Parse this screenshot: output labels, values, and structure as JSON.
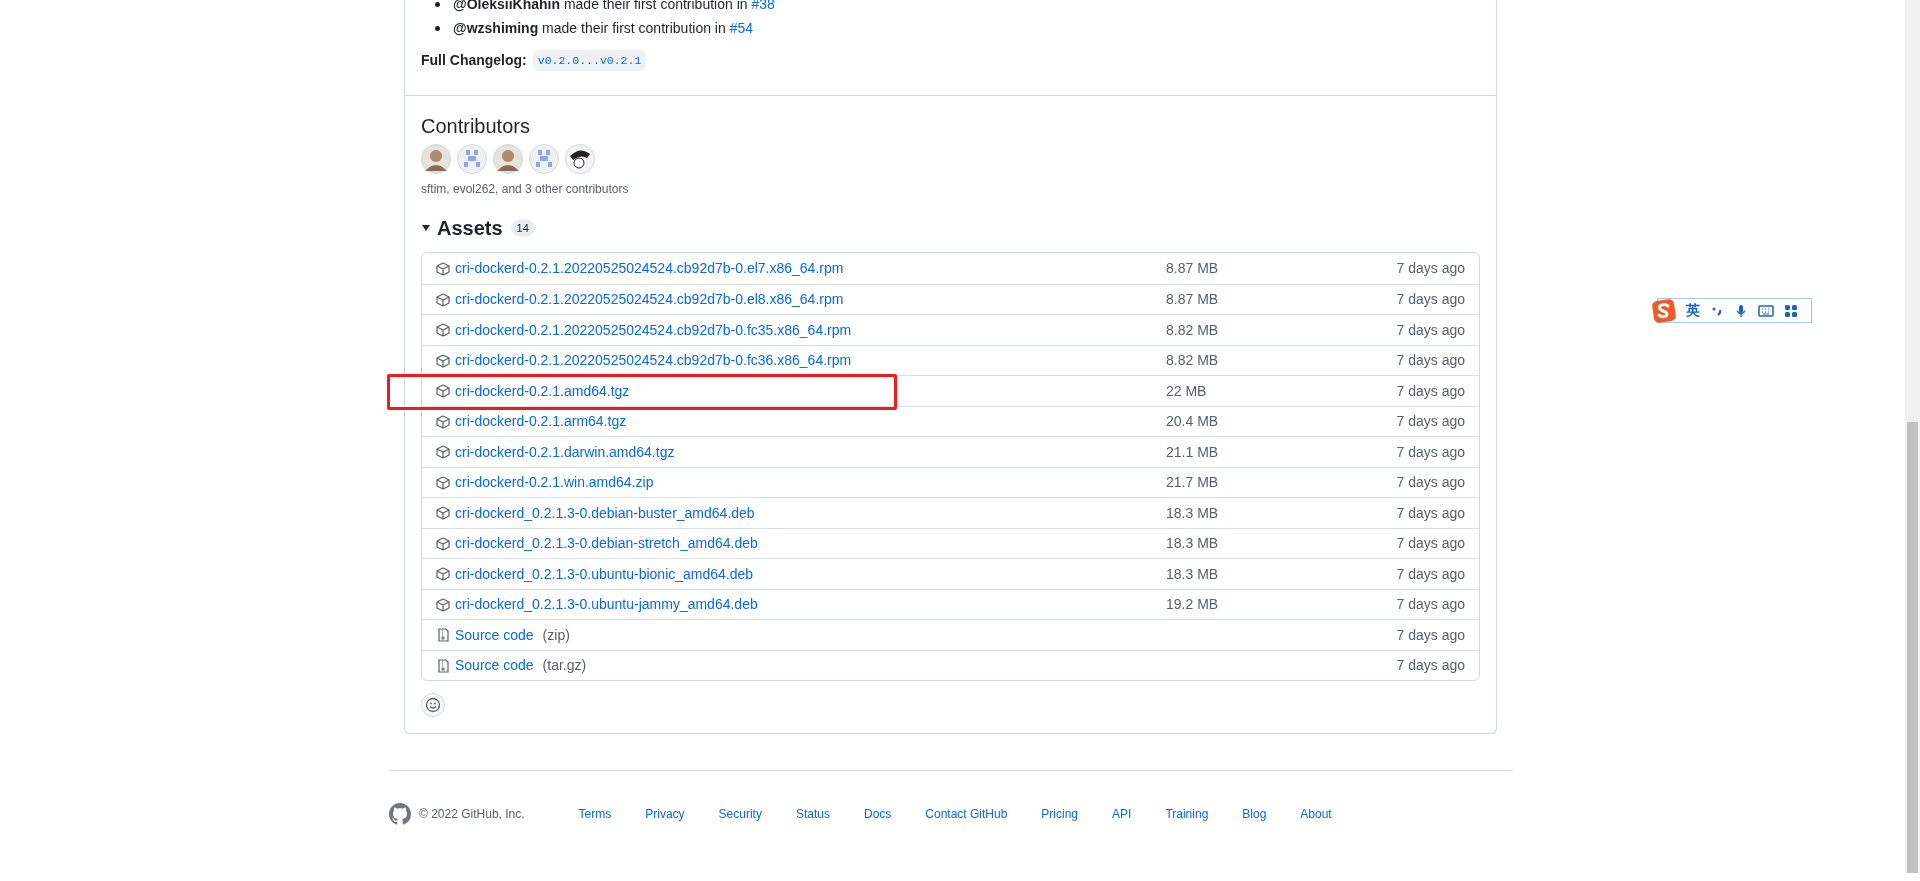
{
  "release_notes": {
    "new_contributors": [
      {
        "user": "@OleksiiKhahin",
        "text": "made their first contribution in",
        "link": "#38"
      },
      {
        "user": "@wzshiming",
        "text": "made their first contribution in",
        "link": "#54"
      }
    ],
    "changelog_label": "Full Changelog:",
    "changelog_link": "v0.2.0...v0.2.1"
  },
  "contributors": {
    "title": "Contributors",
    "avatars": [
      {
        "kind": "photo"
      },
      {
        "kind": "identicon"
      },
      {
        "kind": "photo"
      },
      {
        "kind": "identicon"
      },
      {
        "kind": "cartoon"
      }
    ],
    "summary": "sftim, evol262, and 3 other contributors"
  },
  "assets": {
    "title": "Assets",
    "count": "14",
    "expanded": true,
    "items": [
      {
        "kind": "package",
        "name": "cri-dockerd-0.2.1.20220525024524.cb92d7b-0.el7.x86_64.rpm",
        "size": "8.87 MB",
        "date": "7 days ago",
        "highlighted": false
      },
      {
        "kind": "package",
        "name": "cri-dockerd-0.2.1.20220525024524.cb92d7b-0.el8.x86_64.rpm",
        "size": "8.87 MB",
        "date": "7 days ago",
        "highlighted": false
      },
      {
        "kind": "package",
        "name": "cri-dockerd-0.2.1.20220525024524.cb92d7b-0.fc35.x86_64.rpm",
        "size": "8.82 MB",
        "date": "7 days ago",
        "highlighted": false
      },
      {
        "kind": "package",
        "name": "cri-dockerd-0.2.1.20220525024524.cb92d7b-0.fc36.x86_64.rpm",
        "size": "8.82 MB",
        "date": "7 days ago",
        "highlighted": false
      },
      {
        "kind": "package",
        "name": "cri-dockerd-0.2.1.amd64.tgz",
        "size": "22 MB",
        "date": "7 days ago",
        "highlighted": true
      },
      {
        "kind": "package",
        "name": "cri-dockerd-0.2.1.arm64.tgz",
        "size": "20.4 MB",
        "date": "7 days ago",
        "highlighted": false
      },
      {
        "kind": "package",
        "name": "cri-dockerd-0.2.1.darwin.amd64.tgz",
        "size": "21.1 MB",
        "date": "7 days ago",
        "highlighted": false
      },
      {
        "kind": "package",
        "name": "cri-dockerd-0.2.1.win.amd64.zip",
        "size": "21.7 MB",
        "date": "7 days ago",
        "highlighted": false
      },
      {
        "kind": "package",
        "name": "cri-dockerd_0.2.1.3-0.debian-buster_amd64.deb",
        "size": "18.3 MB",
        "date": "7 days ago",
        "highlighted": false
      },
      {
        "kind": "package",
        "name": "cri-dockerd_0.2.1.3-0.debian-stretch_amd64.deb",
        "size": "18.3 MB",
        "date": "7 days ago",
        "highlighted": false
      },
      {
        "kind": "package",
        "name": "cri-dockerd_0.2.1.3-0.ubuntu-bionic_amd64.deb",
        "size": "18.3 MB",
        "date": "7 days ago",
        "highlighted": false
      },
      {
        "kind": "package",
        "name": "cri-dockerd_0.2.1.3-0.ubuntu-jammy_amd64.deb",
        "size": "19.2 MB",
        "date": "7 days ago",
        "highlighted": false
      },
      {
        "kind": "source",
        "name": "Source code",
        "format": "(zip)",
        "date": "7 days ago",
        "highlighted": false
      },
      {
        "kind": "source",
        "name": "Source code",
        "format": "(tar.gz)",
        "date": "7 days ago",
        "highlighted": false
      }
    ]
  },
  "footer": {
    "copyright": "© 2022 GitHub, Inc.",
    "links": [
      "Terms",
      "Privacy",
      "Security",
      "Status",
      "Docs",
      "Contact GitHub",
      "Pricing",
      "API",
      "Training",
      "Blog",
      "About"
    ]
  },
  "ime_toolbar": {
    "language": "英"
  }
}
